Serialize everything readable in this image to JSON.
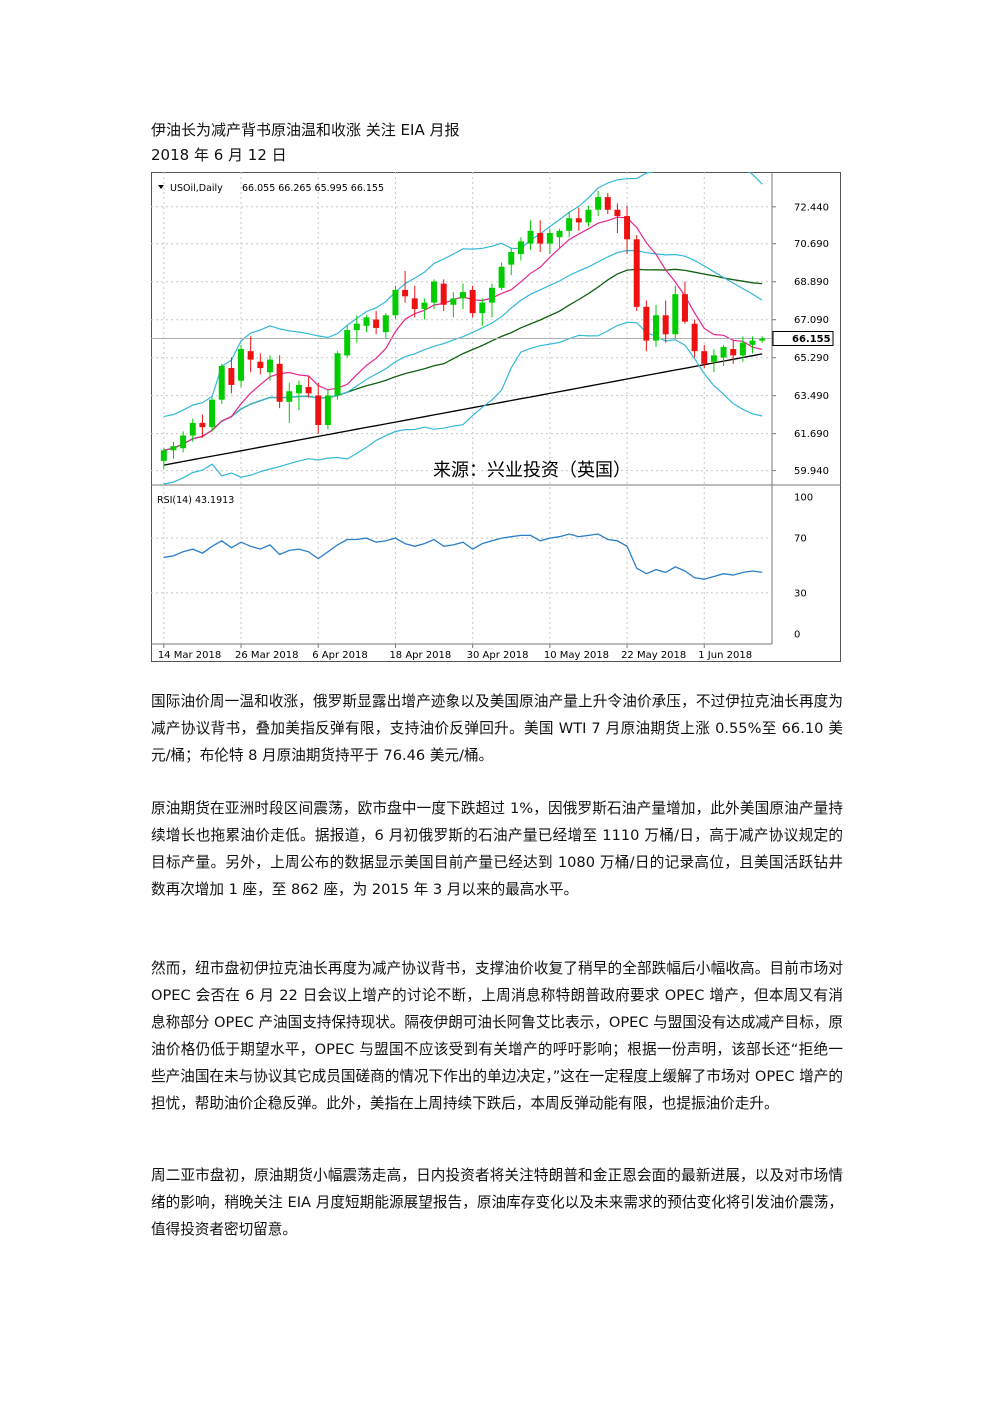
{
  "header": {
    "title": "伊油长为减产背书原油温和收涨 关注 EIA 月报",
    "date": "2018 年 6 月 12 日"
  },
  "chart_data": {
    "type": "candlestick",
    "symbol_label": "USOil,Daily",
    "ohlc_label": "66.055 66.265 65.995 66.155",
    "last_price": "66.155",
    "watermark": "来源：兴业投资（英国）",
    "price_axis_ticks": [
      "72.440",
      "70.690",
      "68.890",
      "67.090",
      "65.290",
      "63.490",
      "61.690",
      "59.940"
    ],
    "price_ticks": [
      72.44,
      70.69,
      68.89,
      67.09,
      65.29,
      63.49,
      61.69,
      59.94
    ],
    "ylim": [
      59.4,
      73.9
    ],
    "date_labels": [
      "14 Mar 2018",
      "26 Mar 2018",
      "6 Apr 2018",
      "18 Apr 2018",
      "30 Apr 2018",
      "10 May 2018",
      "22 May 2018",
      "1 Jun 2018"
    ],
    "date_label_index": [
      0,
      8,
      16,
      24,
      32,
      40,
      48,
      56
    ],
    "candles": [
      [
        60.4,
        61.0,
        60.0,
        60.9
      ],
      [
        60.9,
        61.3,
        60.5,
        61.1
      ],
      [
        61.0,
        61.8,
        60.8,
        61.6
      ],
      [
        61.6,
        62.4,
        61.3,
        62.2
      ],
      [
        62.2,
        62.6,
        61.5,
        62.0
      ],
      [
        62.0,
        63.4,
        61.8,
        63.3
      ],
      [
        63.3,
        65.0,
        63.1,
        64.9
      ],
      [
        64.8,
        65.3,
        63.6,
        64.0
      ],
      [
        64.2,
        65.9,
        63.9,
        65.7
      ],
      [
        65.6,
        66.3,
        64.6,
        65.2
      ],
      [
        65.1,
        65.5,
        64.5,
        64.8
      ],
      [
        64.6,
        65.4,
        64.2,
        65.2
      ],
      [
        65.0,
        65.4,
        62.9,
        63.2
      ],
      [
        63.2,
        64.1,
        62.2,
        63.7
      ],
      [
        63.6,
        64.2,
        62.8,
        64.0
      ],
      [
        63.9,
        64.4,
        63.4,
        63.6
      ],
      [
        63.5,
        64.1,
        61.7,
        62.1
      ],
      [
        62.1,
        63.8,
        61.9,
        63.5
      ],
      [
        63.5,
        65.6,
        63.3,
        65.5
      ],
      [
        65.4,
        66.8,
        65.3,
        66.6
      ],
      [
        66.6,
        67.3,
        66.0,
        66.9
      ],
      [
        66.8,
        67.3,
        66.5,
        67.2
      ],
      [
        67.1,
        67.5,
        66.4,
        66.7
      ],
      [
        66.5,
        67.4,
        66.2,
        67.3
      ],
      [
        67.3,
        68.7,
        67.1,
        68.5
      ],
      [
        68.5,
        69.4,
        67.9,
        68.2
      ],
      [
        68.1,
        68.7,
        67.2,
        67.6
      ],
      [
        67.6,
        68.1,
        67.1,
        67.9
      ],
      [
        67.9,
        69.0,
        67.6,
        68.9
      ],
      [
        68.8,
        69.0,
        67.5,
        67.8
      ],
      [
        67.8,
        68.4,
        67.2,
        68.1
      ],
      [
        68.1,
        68.8,
        67.6,
        68.4
      ],
      [
        68.5,
        68.7,
        67.2,
        67.4
      ],
      [
        67.4,
        68.1,
        66.8,
        67.9
      ],
      [
        67.9,
        68.8,
        67.2,
        68.6
      ],
      [
        68.6,
        69.8,
        68.5,
        69.6
      ],
      [
        69.7,
        70.5,
        69.2,
        70.3
      ],
      [
        70.2,
        71.0,
        69.9,
        70.8
      ],
      [
        70.7,
        71.8,
        70.4,
        71.3
      ],
      [
        71.2,
        71.8,
        70.3,
        70.7
      ],
      [
        70.7,
        71.4,
        70.2,
        71.2
      ],
      [
        71.0,
        71.4,
        70.5,
        71.3
      ],
      [
        71.3,
        72.2,
        71.0,
        71.9
      ],
      [
        71.9,
        72.4,
        71.3,
        71.7
      ],
      [
        71.7,
        72.5,
        71.5,
        72.3
      ],
      [
        72.3,
        73.2,
        72.0,
        72.9
      ],
      [
        72.9,
        73.1,
        72.1,
        72.3
      ],
      [
        72.3,
        72.6,
        71.2,
        72.0
      ],
      [
        72.0,
        72.5,
        70.2,
        70.9
      ],
      [
        70.9,
        71.1,
        67.5,
        67.7
      ],
      [
        67.7,
        68.0,
        65.6,
        66.1
      ],
      [
        66.1,
        67.8,
        65.8,
        67.3
      ],
      [
        67.3,
        68.0,
        66.0,
        66.4
      ],
      [
        66.4,
        68.7,
        66.2,
        68.3
      ],
      [
        68.3,
        68.9,
        66.9,
        67.0
      ],
      [
        66.9,
        67.1,
        65.3,
        65.6
      ],
      [
        65.6,
        65.9,
        64.8,
        65.0
      ],
      [
        65.1,
        65.7,
        64.6,
        65.4
      ],
      [
        65.3,
        65.9,
        64.9,
        65.8
      ],
      [
        65.7,
        66.1,
        65.0,
        65.4
      ],
      [
        65.4,
        66.3,
        65.1,
        66.0
      ],
      [
        65.9,
        66.3,
        65.5,
        66.1
      ],
      [
        66.1,
        66.3,
        66.0,
        66.2
      ]
    ],
    "rsi_label": "RSI(14) 43.1913",
    "rsi_axis_ticks": [
      "100",
      "70",
      "30",
      "0"
    ],
    "rsi_ticks": [
      100,
      70,
      30,
      0
    ],
    "rsi_values": [
      56,
      57,
      60,
      62,
      59,
      64,
      68,
      63,
      67,
      64,
      62,
      65,
      58,
      61,
      62,
      60,
      55,
      60,
      65,
      69,
      69,
      70,
      67,
      68,
      70,
      66,
      64,
      66,
      69,
      64,
      65,
      67,
      62,
      66,
      68,
      70,
      71,
      72,
      72,
      68,
      70,
      71,
      73,
      71,
      72,
      73,
      69,
      68,
      64,
      48,
      44,
      47,
      45,
      49,
      46,
      41,
      40,
      42,
      44,
      43,
      45,
      46,
      45
    ],
    "colors": {
      "bull": "#00cc00",
      "bear": "#ee1111",
      "bollinger": "#33b8d8",
      "ma_short": "#e8238e",
      "ma_mid": "#106010",
      "ma_long": "#000000",
      "rsi": "#2c7ec8"
    }
  },
  "paragraphs": [
    "国际油价周一温和收涨，俄罗斯显露出增产迹象以及美国原油产量上升令油价承压，不过伊拉克油长再度为减产协议背书，叠加美指反弹有限，支持油价反弹回升。美国 WTI 7 月原油期货上涨 0.55%至 66.10 美元/桶；布伦特 8 月原油期货持平于 76.46 美元/桶。",
    "原油期货在亚洲时段区间震荡，欧市盘中一度下跌超过 1%，因俄罗斯石油产量增加，此外美国原油产量持续增长也拖累油价走低。据报道，6 月初俄罗斯的石油产量已经增至 1110 万桶/日，高于减产协议规定的目标产量。另外，上周公布的数据显示美国目前产量已经达到 1080 万桶/日的记录高位，且美国活跃钻井数再次增加 1 座，至 862 座，为 2015 年 3 月以来的最高水平。",
    "然而，纽市盘初伊拉克油长再度为减产协议背书，支撑油价收复了稍早的全部跌幅后小幅收高。目前市场对 OPEC 会否在 6 月 22 日会议上增产的讨论不断，上周消息称特朗普政府要求 OPEC 增产，但本周又有消息称部分 OPEC 产油国支持保持现状。隔夜伊朗可油长阿鲁艾比表示，OPEC 与盟国没有达成减产目标，原油价格仍低于期望水平，OPEC 与盟国不应该受到有关增产的呼吁影响；根据一份声明，该部长还“拒绝一些产油国在未与协议其它成员国磋商的情况下作出的单边决定，”这在一定程度上缓解了市场对 OPEC 增产的担忧，帮助油价企稳反弹。此外，美指在上周持续下跌后，本周反弹动能有限，也提振油价走升。",
    "周二亚市盘初，原油期货小幅震荡走高，日内投资者将关注特朗普和金正恩会面的最新进展，以及对市场情绪的影响，稍晚关注 EIA 月度短期能源展望报告，原油库存变化以及未来需求的预估变化将引发油价震荡，值得投资者密切留意。"
  ]
}
